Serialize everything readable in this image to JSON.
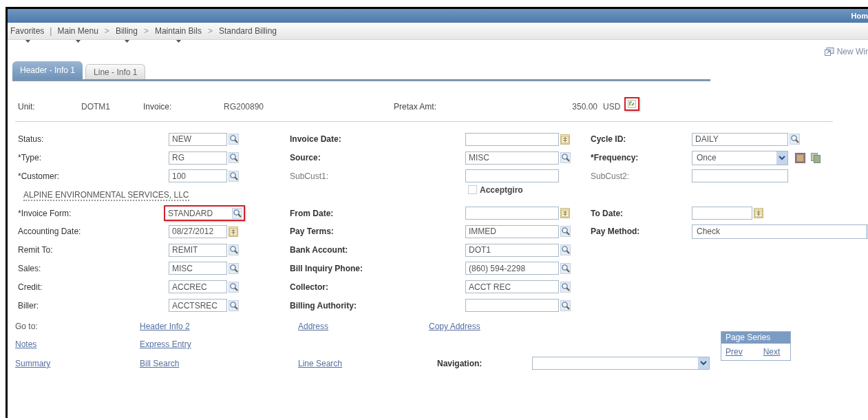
{
  "header_bar": {
    "link": "Hom"
  },
  "breadcrumb": [
    {
      "label": "Favorites",
      "menu": true,
      "separator": "|"
    },
    {
      "label": "Main Menu",
      "menu": true,
      "separator": ">"
    },
    {
      "label": "Billing",
      "menu": true,
      "separator": ">"
    },
    {
      "label": "Maintain Bils",
      "menu": true,
      "separator": ">"
    },
    {
      "label": "Standard Billing",
      "menu": false
    }
  ],
  "new_window_link": "New Wir",
  "tabs": [
    {
      "label": "Header - Info 1",
      "selected": true
    },
    {
      "label": "Line - Info 1",
      "selected": false
    }
  ],
  "summary": {
    "unit_label": "Unit:",
    "unit": "DOTM1",
    "invoice_label": "Invoice:",
    "invoice": "RG200890",
    "pretax_label": "Pretax Amt:",
    "pretax_amount": "350.00",
    "currency": "USD",
    "highlighted": true
  },
  "form_rows": [
    {
      "left": {
        "kind": "lookup",
        "label": "Status:",
        "value": "NEW"
      },
      "middle": {
        "kind": "date",
        "label": "Invoice Date:"
      },
      "right": {
        "kind": "lookup",
        "label": "Cycle ID:",
        "value": "DAILY"
      }
    },
    {
      "left": {
        "kind": "lookup",
        "label": "*Type:",
        "value": "RG"
      },
      "middle": {
        "kind": "lookup",
        "label": "Source:",
        "value": "MISC"
      },
      "right": {
        "kind": "select",
        "label": "*Frequency:",
        "value": "Once",
        "actions": true
      }
    },
    {
      "left": {
        "kind": "lookup",
        "label": "*Customer:",
        "value": "100"
      },
      "middle": {
        "kind": "text",
        "label": "SubCust1:",
        "muted": true
      },
      "right": {
        "kind": "text",
        "label": "SubCust2:",
        "muted": true
      }
    },
    {
      "left": {
        "kind": "note",
        "text": "ALPINE ENVIRONMENTAL SERVICES, LLC"
      },
      "middle": {
        "kind": "checkbox",
        "label": "Acceptgiro",
        "checked": false
      }
    },
    {
      "left": {
        "kind": "lookup",
        "label": "*Invoice Form:",
        "value": "STANDARD",
        "highlighted": true
      },
      "middle": {
        "kind": "date",
        "label": "From Date:"
      },
      "right": {
        "kind": "date",
        "label": "To Date:"
      }
    },
    {
      "left": {
        "kind": "date",
        "label": "Accounting Date:",
        "value": "08/27/2012"
      },
      "middle": {
        "kind": "lookup",
        "label": "Pay Terms:",
        "value": "IMMED"
      },
      "right": {
        "kind": "select",
        "label": "Pay Method:",
        "value": "Check"
      }
    },
    {
      "left": {
        "kind": "lookup",
        "label": "Remit To:",
        "value": "REMIT"
      },
      "middle": {
        "kind": "lookup",
        "label": "Bank Account:",
        "value": "DOT1"
      }
    },
    {
      "left": {
        "kind": "lookup",
        "label": "Sales:",
        "value": "MISC"
      },
      "middle": {
        "kind": "lookup",
        "label": "Bill Inquiry Phone:",
        "value": "(860) 594-2298"
      }
    },
    {
      "left": {
        "kind": "lookup",
        "label": "Credit:",
        "value": "ACCREC"
      },
      "middle": {
        "kind": "lookup",
        "label": "Collector:",
        "value": "ACCT REC"
      }
    },
    {
      "left": {
        "kind": "lookup",
        "label": "Biller:",
        "value": "ACCTSREC"
      },
      "middle": {
        "kind": "lookup",
        "label": "Billing Authority:"
      }
    }
  ],
  "goto_rows": [
    [
      {
        "kind": "label",
        "text": "Go to:"
      },
      {
        "kind": "link",
        "text": "Header Info 2"
      },
      {
        "kind": "link",
        "text": "Address"
      },
      {
        "kind": "link",
        "text": "Copy Address"
      }
    ],
    [
      {
        "kind": "link",
        "text": "Notes"
      },
      {
        "kind": "link",
        "text": "Express Entry"
      }
    ],
    [
      {
        "kind": "link",
        "text": "Summary"
      },
      {
        "kind": "link",
        "text": "Bill Search"
      },
      {
        "kind": "link",
        "text": "Line Search"
      }
    ]
  ],
  "navigation": {
    "label": "Navigation:"
  },
  "page_series": {
    "title": "Page Series",
    "links": [
      "Prev",
      "Next"
    ]
  }
}
